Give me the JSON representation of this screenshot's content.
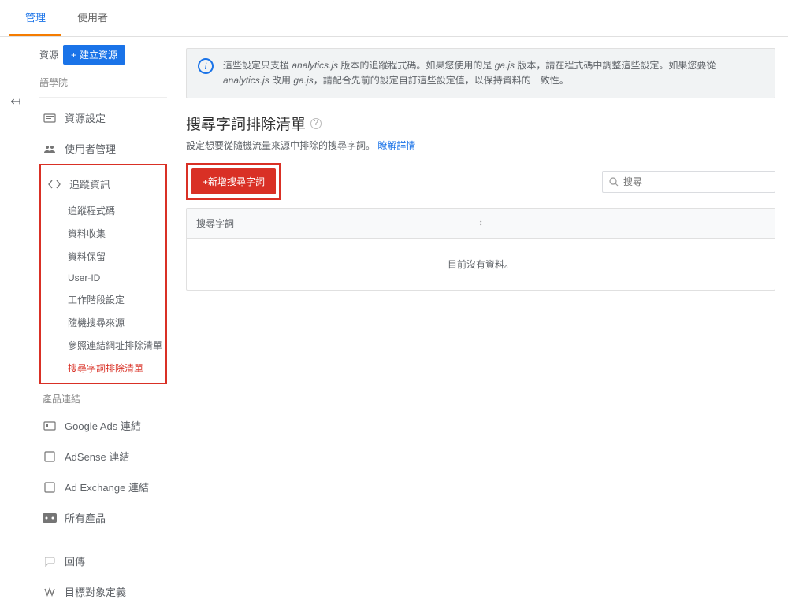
{
  "tabs": {
    "admin": "管理",
    "users": "使用者"
  },
  "sidebar": {
    "property_label": "資源",
    "create_btn": "建立資源",
    "institute": "語學院",
    "items": {
      "property_settings": "資源設定",
      "user_management": "使用者管理",
      "tracking_info": "追蹤資訊"
    },
    "tracking_sub": [
      "追蹤程式碼",
      "資料收集",
      "資料保留",
      "User-ID",
      "工作階段設定",
      "隨機搜尋來源",
      "參照連結網址排除清單",
      "搜尋字詞排除清單"
    ],
    "product_link_label": "產品連結",
    "product_links": [
      "Google Ads 連結",
      "AdSense 連結",
      "Ad Exchange 連結",
      "所有產品"
    ],
    "postback": "回傳",
    "audience_def": "目標對象定義"
  },
  "banner": {
    "text_1": "這些設定只支援 ",
    "analytics_js": "analytics.js",
    "text_2": " 版本的追蹤程式碼。如果您使用的是 ",
    "ga_js": "ga.js",
    "text_3": " 版本，請在程式碼中調整這些設定。如果您要從 ",
    "text_4": " 改用 ",
    "text_5": "，請配合先前的設定自訂這些設定值，以保持資料的一致性。"
  },
  "page": {
    "title": "搜尋字詞排除清單",
    "desc": "設定想要從隨機流量來源中排除的搜尋字詞。",
    "learn_more": "瞭解詳情"
  },
  "actions": {
    "add_btn": "+新增搜尋字詞",
    "search_placeholder": "搜尋"
  },
  "table": {
    "header": "搜尋字詞",
    "empty": "目前沒有資料。"
  }
}
